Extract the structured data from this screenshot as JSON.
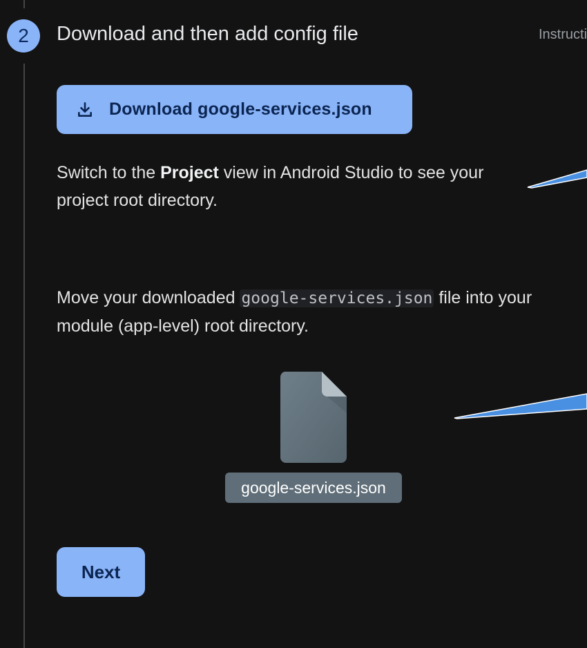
{
  "step": {
    "number": "2",
    "title": "Download and then add config file",
    "side_link": "Instructions for Android Studio below"
  },
  "download_button": {
    "label": "Download google-services.json",
    "icon": "download-icon"
  },
  "paragraph1": {
    "pre": "Switch to the ",
    "bold": "Project",
    "post": " view in Android Studio to see your project root directory."
  },
  "paragraph2": {
    "pre": "Move your downloaded ",
    "code": "google-services.json",
    "post": " file into your module (app-level) root directory."
  },
  "file_preview": {
    "icon": "file-icon",
    "name": "google-services.json"
  },
  "next_button": {
    "label": "Next"
  },
  "colors": {
    "background": "#131313",
    "accent": "#8ab4f8",
    "pointer_blue": "#4a90e2",
    "file_label_bg": "#5f6e78"
  }
}
